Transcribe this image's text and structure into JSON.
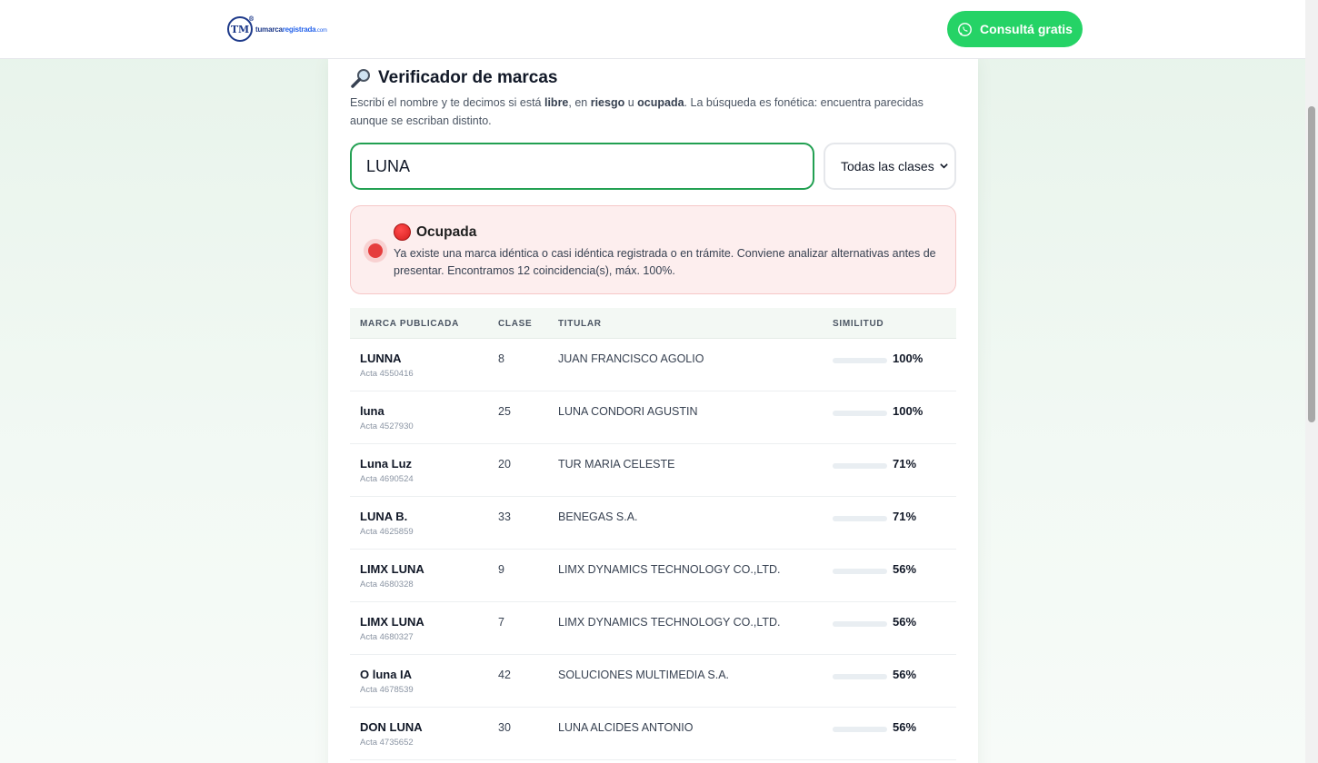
{
  "header": {
    "logo": {
      "mark": "TM",
      "text_a": "tumarca",
      "text_b": "registrada",
      "text_c": ".com"
    },
    "cta_label": "Consultá gratis",
    "cta_color": "#25d366"
  },
  "checker": {
    "title": "Verificador de marcas",
    "title_icon": "magnifier-icon",
    "subtitle": {
      "p1": "Escribí el nombre y te decimos si está ",
      "w1": "libre",
      "p2": ", en ",
      "w2": "riesgo",
      "p3": " u ",
      "w3": "ocupada",
      "p4": ". La búsqueda es fonética: encuentra parecidas aunque se escriban distinto."
    },
    "search_value": "LUNA",
    "class_select": {
      "selected": "Todas las clases"
    }
  },
  "result": {
    "status": "Ocupada",
    "status_color": "#e53e3e",
    "message": "Ya existe una marca idéntica o casi idéntica registrada o en trámite. Conviene analizar alternativas antes de presentar. Encontramos 12 coincidencia(s), máx. 100%."
  },
  "table": {
    "headers": [
      "MARCA PUBLICADA",
      "CLASE",
      "TITULAR",
      "SIMILITUD"
    ],
    "rows": [
      {
        "mark": "LUNNA",
        "acta": "Acta 4550416",
        "clase": "8",
        "titular": "JUAN FRANCISCO AGOLIO",
        "similitud": "100%",
        "sim_value": 100
      },
      {
        "mark": "luna",
        "acta": "Acta 4527930",
        "clase": "25",
        "titular": "LUNA CONDORI AGUSTIN",
        "similitud": "100%",
        "sim_value": 100
      },
      {
        "mark": "Luna Luz",
        "acta": "Acta 4690524",
        "clase": "20",
        "titular": "TUR MARIA CELESTE",
        "similitud": "71%",
        "sim_value": 71
      },
      {
        "mark": "LUNA B.",
        "acta": "Acta 4625859",
        "clase": "33",
        "titular": "BENEGAS S.A.",
        "similitud": "71%",
        "sim_value": 71
      },
      {
        "mark": "LIMX LUNA",
        "acta": "Acta 4680328",
        "clase": "9",
        "titular": "LIMX DYNAMICS TECHNOLOGY CO.,LTD.",
        "similitud": "56%",
        "sim_value": 56
      },
      {
        "mark": "LIMX LUNA",
        "acta": "Acta 4680327",
        "clase": "7",
        "titular": "LIMX DYNAMICS TECHNOLOGY CO.,LTD.",
        "similitud": "56%",
        "sim_value": 56
      },
      {
        "mark": "O luna IA",
        "acta": "Acta 4678539",
        "clase": "42",
        "titular": "SOLUCIONES MULTIMEDIA S.A.",
        "similitud": "56%",
        "sim_value": 56
      },
      {
        "mark": "DON LUNA",
        "acta": "Acta 4735652",
        "clase": "30",
        "titular": "LUNA ALCIDES ANTONIO",
        "similitud": "56%",
        "sim_value": 56
      }
    ]
  }
}
